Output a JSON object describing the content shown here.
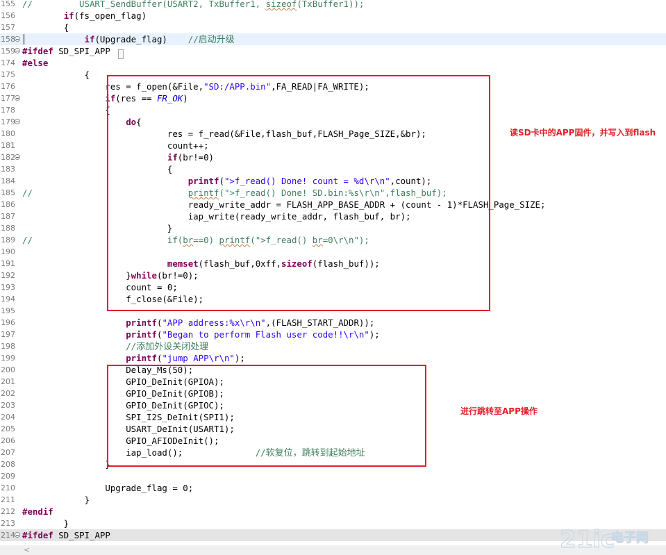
{
  "code_lines": [
    {
      "num": "155",
      "fold": false,
      "cls": "",
      "html": "<span class=\"cm\">//         USART_SendBuffer(USART2, TxBuffer1, <span class=\"sq\">sizeof</span>(TxBuffer1));</span>"
    },
    {
      "num": "156",
      "fold": false,
      "cls": "",
      "html": "        <span class=\"kw\">if</span>(fs_open_flag)"
    },
    {
      "num": "157",
      "fold": false,
      "cls": "",
      "html": "        {"
    },
    {
      "num": "158",
      "fold": true,
      "cls": "hl",
      "html": "            <span class=\"kw\">if</span>(Upgrade_flag)    <span class=\"cm\">//<span class=\"cn\">启动升级</span></span>"
    },
    {
      "num": "159",
      "fold": true,
      "cls": "",
      "html": "<span class=\"pp\">#ifdef</span> SD_SPI_APP"
    },
    {
      "num": "174",
      "fold": false,
      "cls": "",
      "html": "<span class=\"pp\">#else</span>"
    },
    {
      "num": "175",
      "fold": false,
      "cls": "",
      "html": "            {"
    },
    {
      "num": "176",
      "fold": false,
      "cls": "",
      "html": "                res = f_open(&amp;File,<span class=\"str\">\"SD:/APP.bin\"</span>,FA_READ|FA_WRITE);"
    },
    {
      "num": "177",
      "fold": true,
      "cls": "",
      "html": "                <span class=\"kw\">if</span>(res == <span class=\"it\">FR_OK</span>)"
    },
    {
      "num": "178",
      "fold": false,
      "cls": "",
      "html": "                {"
    },
    {
      "num": "179",
      "fold": true,
      "cls": "",
      "html": "                    <span class=\"kw\">do</span>{"
    },
    {
      "num": "180",
      "fold": false,
      "cls": "",
      "html": "                            res = f_read(&amp;File,flash_buf,FLASH_Page_SIZE,&amp;br);"
    },
    {
      "num": "181",
      "fold": false,
      "cls": "",
      "html": "                            count++;"
    },
    {
      "num": "182",
      "fold": true,
      "cls": "",
      "html": "                            <span class=\"kw\">if</span>(br!=0)"
    },
    {
      "num": "183",
      "fold": false,
      "cls": "",
      "html": "                            {"
    },
    {
      "num": "184",
      "fold": false,
      "cls": "",
      "html": "                                <span class=\"kw\">printf</span>(<span class=\"str\">\"&gt;f_read() Done! count = %d\\r\\n\"</span>,count);"
    },
    {
      "num": "185",
      "fold": false,
      "cls": "",
      "html": "<span class=\"cm\">//                              <span class=\"sq\">printf</span>(\"&gt;f_read() Done! SD.bin:%s\\r\\n\",flash_buf);</span>"
    },
    {
      "num": "186",
      "fold": false,
      "cls": "",
      "html": "                                ready_write_addr = FLASH_APP_BASE_ADDR + (count - 1)*FLASH_Page_SIZE;"
    },
    {
      "num": "187",
      "fold": false,
      "cls": "",
      "html": "                                iap_write(ready_write_addr, flash_buf, br);"
    },
    {
      "num": "188",
      "fold": false,
      "cls": "",
      "html": "                            }"
    },
    {
      "num": "189",
      "fold": false,
      "cls": "",
      "html": "<span class=\"cm\">//                          if(<span class=\"sq\">br</span>==0) <span class=\"sq\">printf</span>(\"&gt;f_read() <span class=\"sq\">br</span>=0\\r\\n\");</span>"
    },
    {
      "num": "190",
      "fold": false,
      "cls": "",
      "html": ""
    },
    {
      "num": "191",
      "fold": false,
      "cls": "",
      "html": "                            <span class=\"kw\">memset</span>(flash_buf,0xff,<span class=\"kw\">sizeof</span>(flash_buf));"
    },
    {
      "num": "192",
      "fold": false,
      "cls": "",
      "html": "                    }<span class=\"kw\">while</span>(br!=0);"
    },
    {
      "num": "193",
      "fold": false,
      "cls": "",
      "html": "                    count = 0;"
    },
    {
      "num": "194",
      "fold": false,
      "cls": "",
      "html": "                    f_close(&amp;File);"
    },
    {
      "num": "195",
      "fold": false,
      "cls": "",
      "html": ""
    },
    {
      "num": "196",
      "fold": false,
      "cls": "",
      "html": "                    <span class=\"kw\">printf</span>(<span class=\"str\">\"APP address:%x\\r\\n\"</span>,(FLASH_START_ADDR));"
    },
    {
      "num": "197",
      "fold": false,
      "cls": "",
      "html": "                    <span class=\"kw\">printf</span>(<span class=\"str\">\"Began to perform Flash user code!!\\r\\n\"</span>);"
    },
    {
      "num": "198",
      "fold": false,
      "cls": "",
      "html": "                    <span class=\"cm\">//<span class=\"cn\">添加外设关闭处理</span></span>"
    },
    {
      "num": "199",
      "fold": false,
      "cls": "",
      "html": "                    <span class=\"kw\">printf</span>(<span class=\"str\">\"jump APP\\r\\n\"</span>);"
    },
    {
      "num": "200",
      "fold": false,
      "cls": "",
      "html": "                    Delay_Ms(50);"
    },
    {
      "num": "201",
      "fold": false,
      "cls": "",
      "html": "                    GPIO_DeInit(GPIOA);"
    },
    {
      "num": "202",
      "fold": false,
      "cls": "",
      "html": "                    GPIO_DeInit(GPIOB);"
    },
    {
      "num": "203",
      "fold": false,
      "cls": "",
      "html": "                    GPIO_DeInit(GPIOC);"
    },
    {
      "num": "204",
      "fold": false,
      "cls": "",
      "html": "                    SPI_I2S_DeInit(SPI1);"
    },
    {
      "num": "205",
      "fold": false,
      "cls": "",
      "html": "                    USART_DeInit(USART1);"
    },
    {
      "num": "206",
      "fold": false,
      "cls": "",
      "html": "                    GPIO_AFIODeInit();"
    },
    {
      "num": "207",
      "fold": false,
      "cls": "",
      "html": "                    iap_load();              <span class=\"cm\">//<span class=\"cn\">软复位，跳转到起始地址</span></span>"
    },
    {
      "num": "208",
      "fold": false,
      "cls": "",
      "html": "                }"
    },
    {
      "num": "209",
      "fold": false,
      "cls": "",
      "html": ""
    },
    {
      "num": "210",
      "fold": false,
      "cls": "",
      "html": "                Upgrade_flag = 0;"
    },
    {
      "num": "211",
      "fold": false,
      "cls": "",
      "html": "            }"
    },
    {
      "num": "212",
      "fold": false,
      "cls": "",
      "html": "<span class=\"pp\">#endif</span>"
    },
    {
      "num": "213",
      "fold": false,
      "cls": "",
      "html": "        }"
    },
    {
      "num": "214",
      "fold": true,
      "cls": "gray",
      "html": "<span class=\"pp\">#ifdef</span> SD_SPI_APP"
    }
  ],
  "annotations": {
    "note1": "读SD卡中的APP固件，并写入到flash",
    "note2": "进行跳转至APP操作"
  },
  "colors": {
    "annotation_red": "#e0202a",
    "keyword": "#7f0055",
    "string": "#2a00ff",
    "comment": "#3f7f5f",
    "constant": "#0000c0",
    "current_line": "#e8f2fe"
  },
  "scrollbar": {
    "left_arrow": "<"
  },
  "watermark": {
    "brand": "21ic",
    "tagline": "电子网"
  }
}
